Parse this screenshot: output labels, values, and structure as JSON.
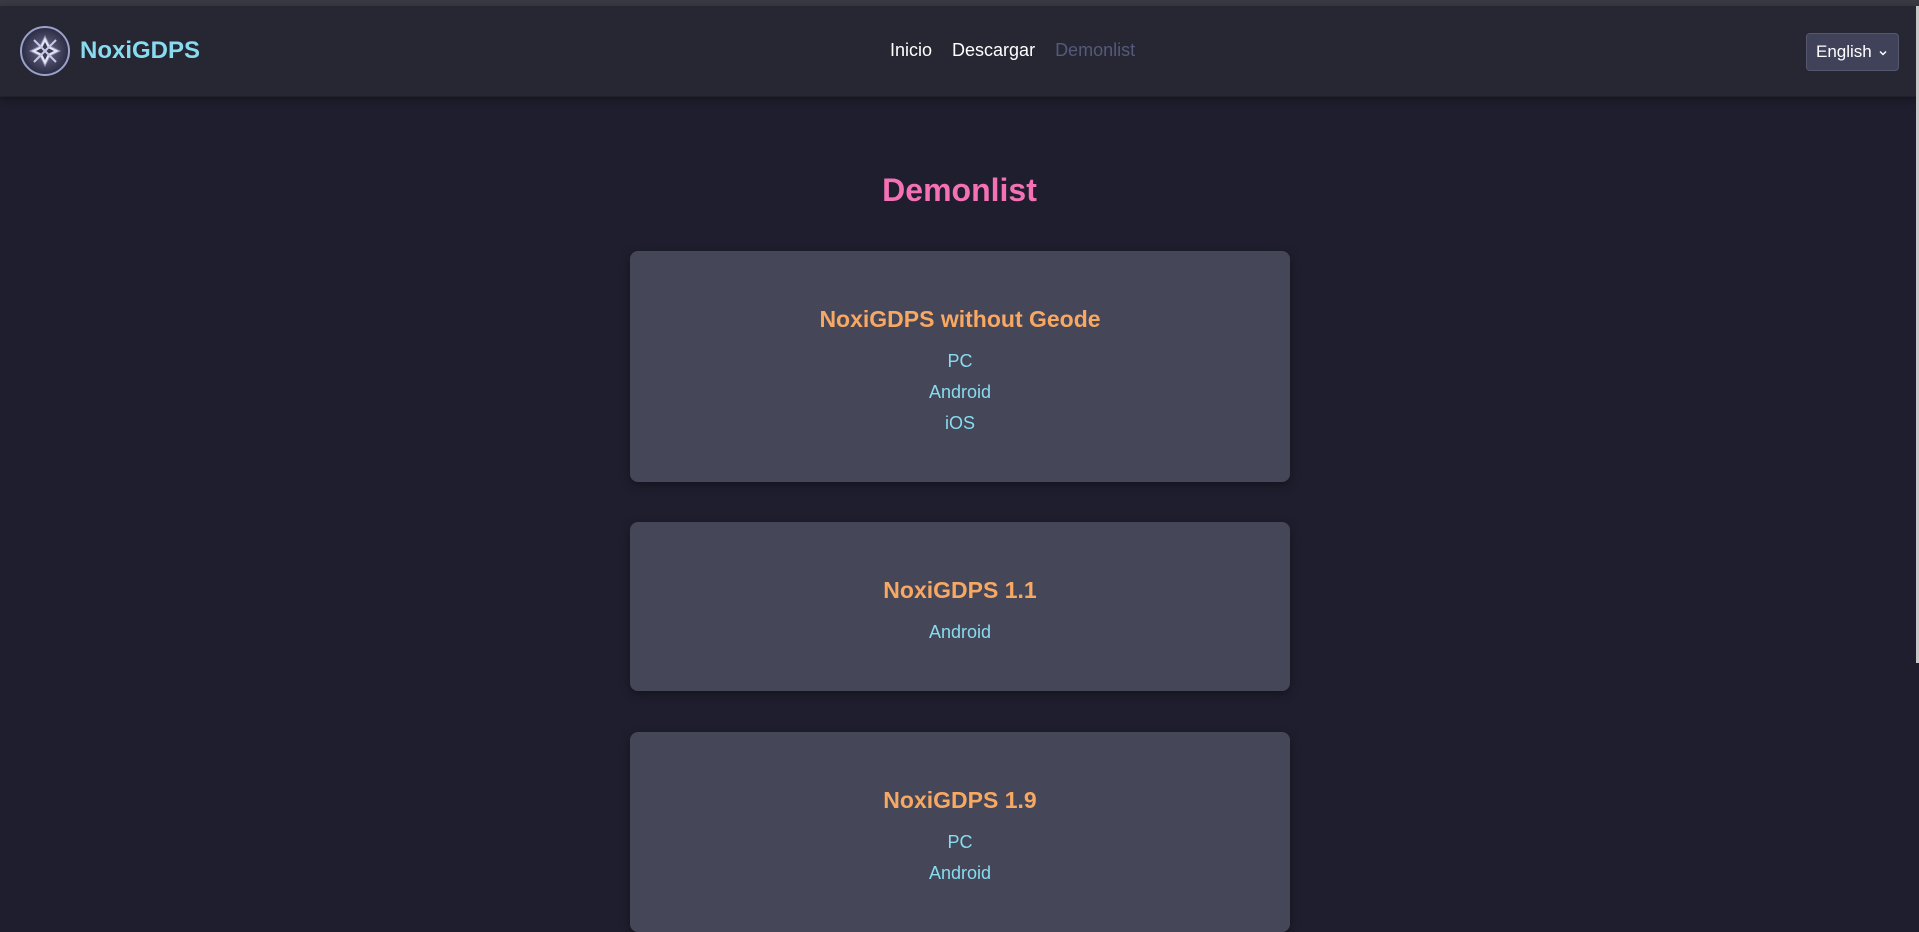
{
  "brand": {
    "name": "NoxiGDPS",
    "logo_icon": "noxi-logo-icon"
  },
  "nav": [
    {
      "label": "Inicio",
      "active": false
    },
    {
      "label": "Descargar",
      "active": false
    },
    {
      "label": "Demonlist",
      "active": true
    }
  ],
  "language": {
    "selected": "English"
  },
  "page": {
    "title": "Demonlist"
  },
  "cards": [
    {
      "title": "NoxiGDPS without Geode",
      "links": [
        "PC",
        "Android",
        "iOS"
      ]
    },
    {
      "title": "NoxiGDPS 1.1",
      "links": [
        "Android"
      ]
    },
    {
      "title": "NoxiGDPS 1.9",
      "links": [
        "PC",
        "Android"
      ]
    }
  ],
  "colors": {
    "background": "#1e1e2e",
    "navbar": "#262733",
    "brand": "#89dcf0",
    "title": "#f471b5",
    "card": "#454658",
    "card_title": "#f7a863",
    "link": "#89dcf0"
  }
}
